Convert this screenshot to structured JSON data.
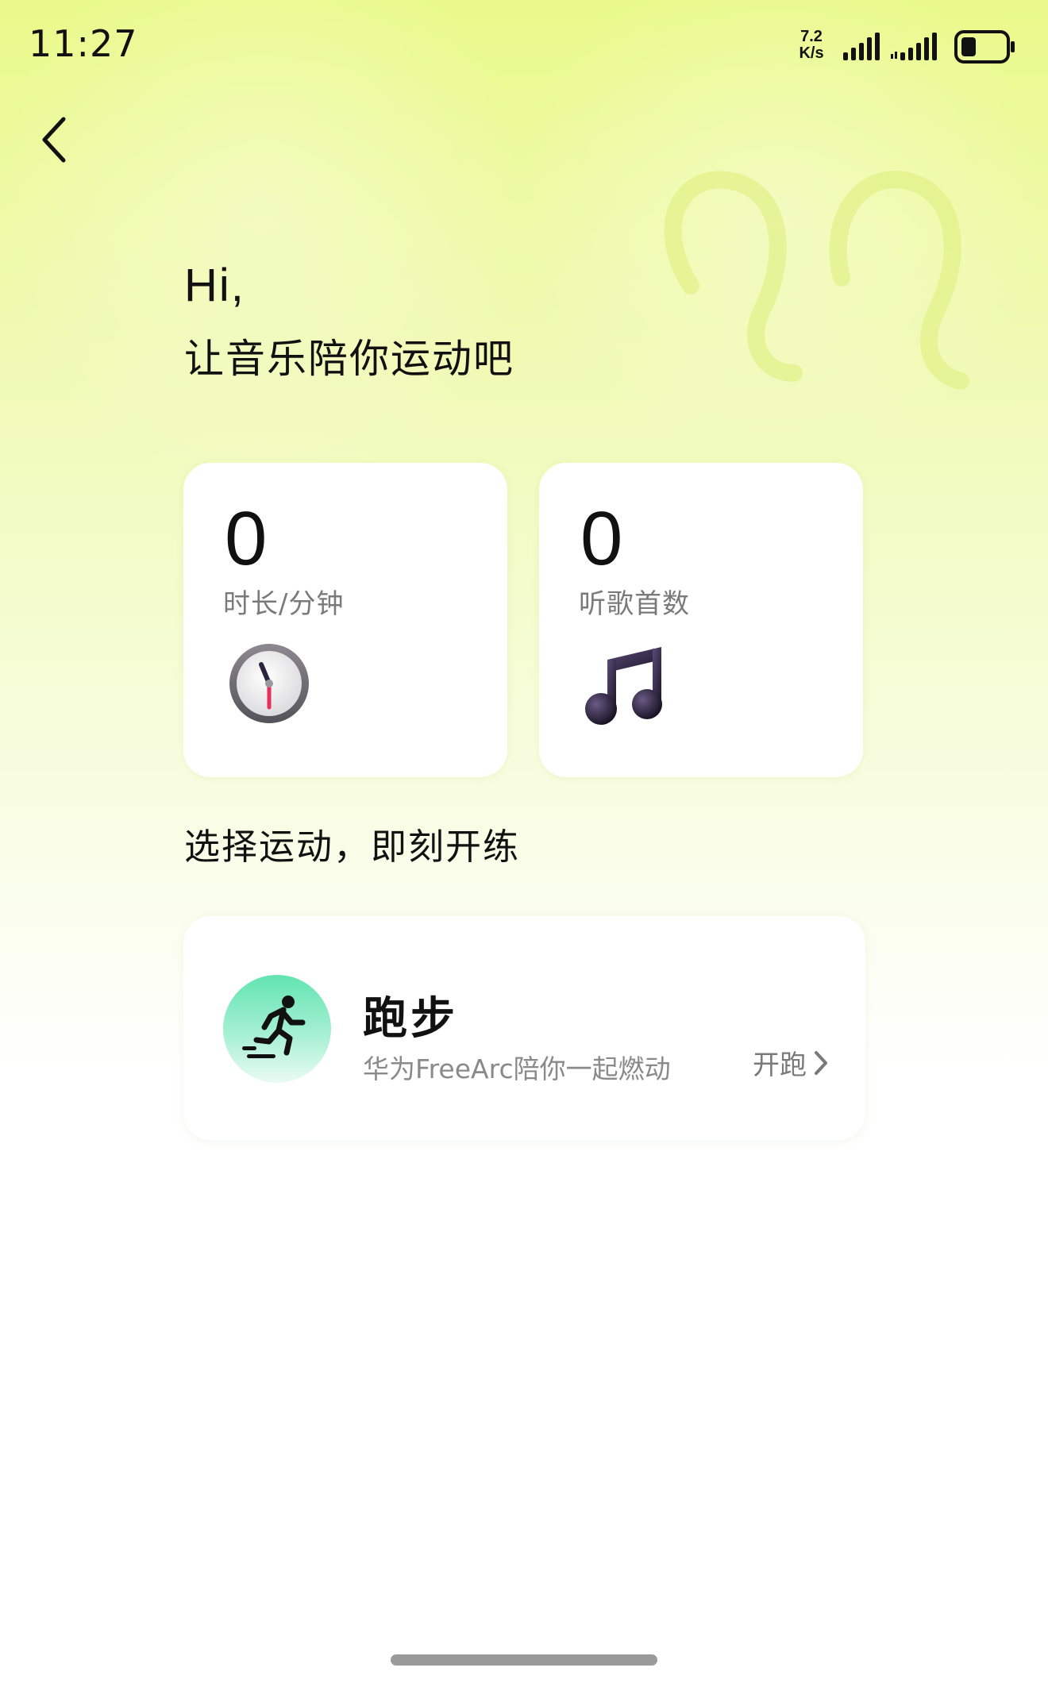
{
  "status_bar": {
    "time": "11:27",
    "net_speed_value": "7.2",
    "net_speed_unit": "K/s",
    "icons": [
      "signal-icon",
      "signal-icon",
      "battery-icon"
    ]
  },
  "nav": {
    "back_icon": "chevron-left-icon"
  },
  "greeting": {
    "hi": "Hi,",
    "subtitle": "让音乐陪你运动吧"
  },
  "stats": {
    "duration": {
      "value": "0",
      "label": "时长/分钟",
      "icon": "clock-icon"
    },
    "songs": {
      "value": "0",
      "label": "听歌首数",
      "icon": "music-note-icon"
    }
  },
  "section": {
    "title": "选择运动，即刻开练"
  },
  "running_card": {
    "title": "跑步",
    "subtitle": "华为FreeArc陪你一起燃动",
    "action_label": "开跑",
    "icon": "running-person-icon",
    "accent_color": "#62e4b2"
  }
}
